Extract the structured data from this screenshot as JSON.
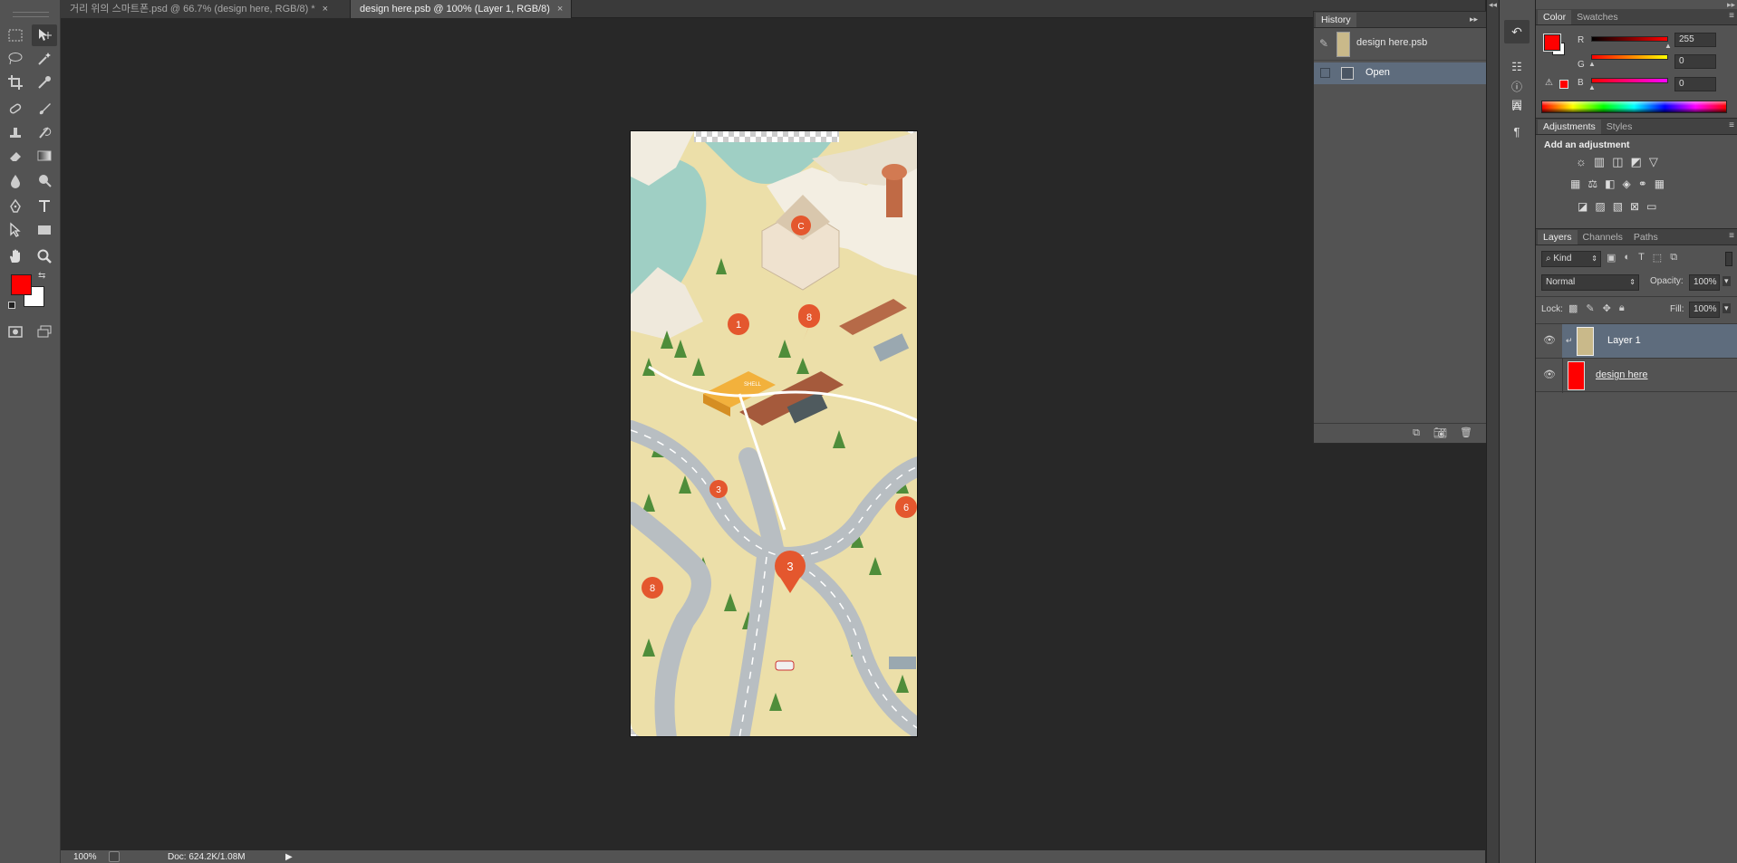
{
  "tabs": [
    {
      "label": "거리 위의 스마트폰.psd @ 66.7% (design here, RGB/8) *",
      "close": "×"
    },
    {
      "label": "design here.psb @ 100% (Layer 1, RGB/8)",
      "close": "×"
    }
  ],
  "status": {
    "zoom": "100%",
    "doc": "Doc: 624.2K/1.08M"
  },
  "history": {
    "tab": "History",
    "snapshot_label": "design here.psb",
    "items": [
      {
        "label": "Open"
      }
    ]
  },
  "color_panel": {
    "tabs": [
      "Color",
      "Swatches"
    ],
    "r_label": "R",
    "r_value": "255",
    "g_label": "G",
    "g_value": "0",
    "b_label": "B",
    "b_value": "0",
    "foreground": "#ff0000",
    "background": "#ffffff"
  },
  "adjustments": {
    "tabs": [
      "Adjustments",
      "Styles"
    ],
    "heading": "Add an adjustment"
  },
  "layers": {
    "tabs": [
      "Layers",
      "Channels",
      "Paths"
    ],
    "filter_kind": "Kind",
    "blend_mode": "Normal",
    "opacity_label": "Opacity:",
    "opacity_value": "100%",
    "lock_label": "Lock:",
    "fill_label": "Fill:",
    "fill_value": "100%",
    "items": [
      {
        "name": "Layer 1",
        "selected": true
      },
      {
        "name": "design here",
        "selected": false,
        "fill": "#ff0000"
      }
    ]
  },
  "map_labels": {
    "pins": [
      "C",
      "1",
      "8",
      "3",
      "6",
      "3",
      "8"
    ],
    "sign": "SHELL"
  }
}
